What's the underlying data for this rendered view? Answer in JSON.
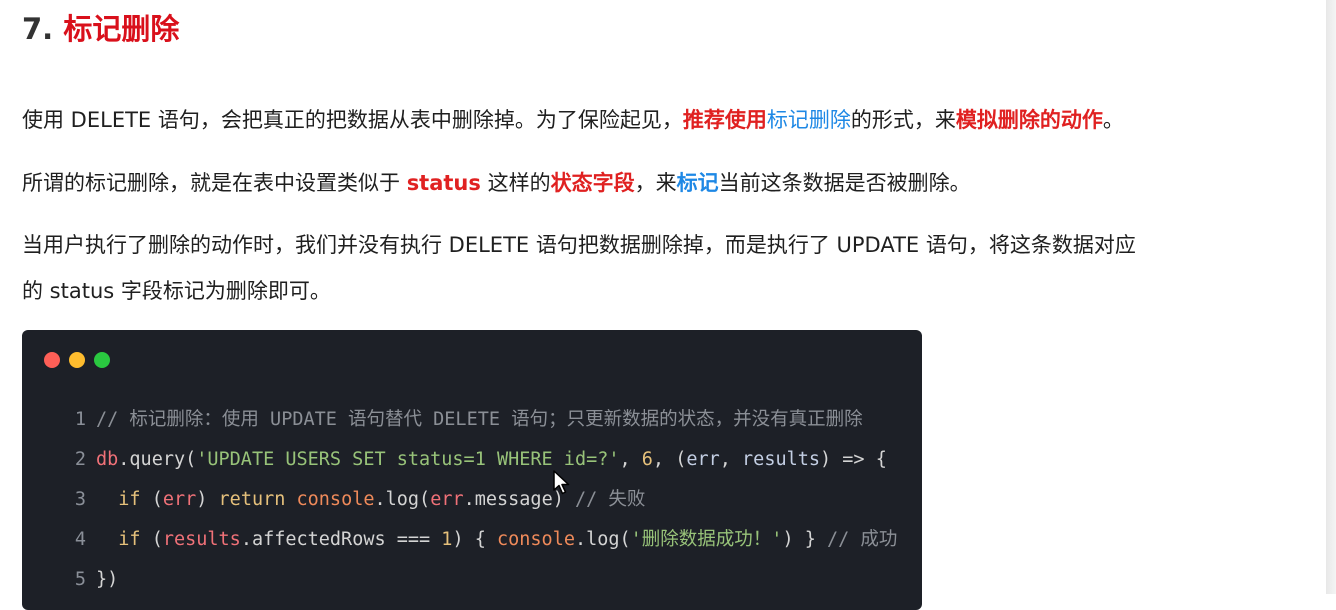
{
  "heading": {
    "number": "7.",
    "title": "标记删除"
  },
  "para1": {
    "t1": "使用 DELETE 语句，会把真正的把数据从表中删除掉。为了保险起见，",
    "red1": "推荐使用",
    "blue1": "标记删除",
    "t2": "的形式，来",
    "red2": "模拟删除的动作",
    "t3": "。"
  },
  "para2": {
    "t1": "所谓的标记删除，就是在表中设置类似于 ",
    "red1": "status",
    "t2": " 这样的",
    "red2": "状态字段",
    "t3": "，来",
    "blue1": "标记",
    "t4": "当前这条数据是否被删除。"
  },
  "para3": {
    "line1": "当用户执行了删除的动作时，我们并没有执行 DELETE 语句把数据删除掉，而是执行了 UPDATE 语句，将这条数据对应",
    "line2": "的 status 字段标记为删除即可。"
  },
  "code": {
    "line_numbers": [
      "1",
      "2",
      "3",
      "4",
      "5"
    ],
    "l1": {
      "comment": "// 标记删除：使用 UPDATE 语句替代 DELETE 语句；只更新数据的状态，并没有真正删除"
    },
    "l2": {
      "db": "db",
      "a": ".query(",
      "str": "'UPDATE USERS SET status=1 WHERE id=?'",
      "b": ", ",
      "num": "6",
      "c": ", (",
      "v1": "err",
      "d": ", ",
      "v2": "results",
      "e": ") => {"
    },
    "l3": {
      "indent": "  ",
      "kw": "if",
      "a": " (",
      "v1": "err",
      "b": ") ",
      "kw2": "return",
      "c": " ",
      "obj": "console",
      "d": ".log(",
      "v2": "err",
      "e": ".message) ",
      "comment": "// 失败"
    },
    "l4": {
      "indent": "  ",
      "kw": "if",
      "a": " (",
      "v1": "results",
      "b": ".affectedRows === ",
      "num": "1",
      "c": ") { ",
      "obj": "console",
      "d": ".log(",
      "str": "'删除数据成功！'",
      "e": ") } ",
      "comment": "// 成功"
    },
    "l5": {
      "a": "})"
    }
  }
}
